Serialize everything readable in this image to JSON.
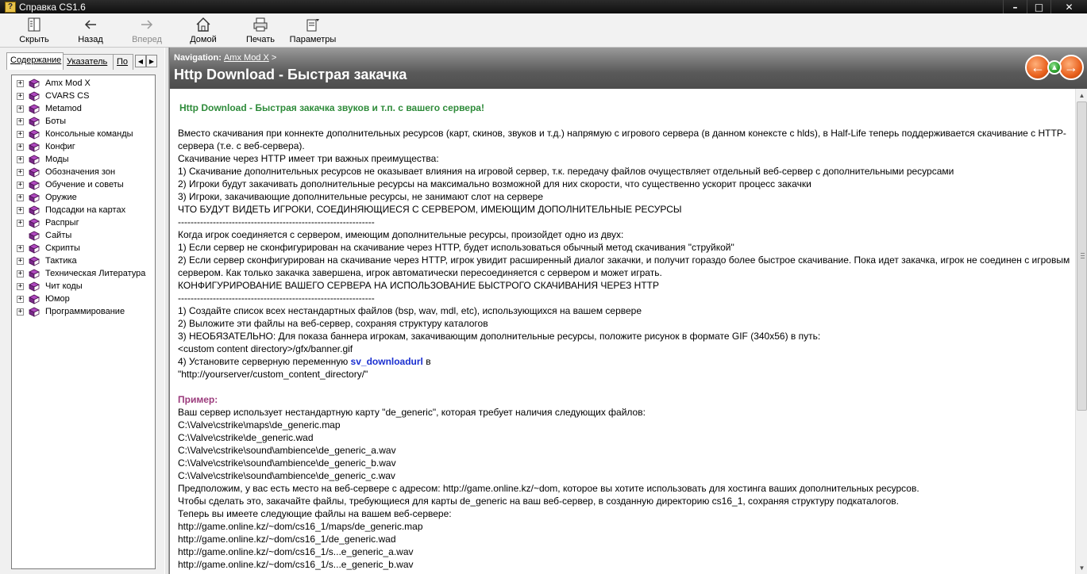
{
  "window": {
    "title": "Справка CS1.6",
    "icon": "help-book-icon",
    "controls": [
      "minimize-icon",
      "maximize-icon",
      "close-icon"
    ]
  },
  "toolbar": {
    "hide_label": "Скрыть",
    "back_label": "Назад",
    "forward_label": "Вперед",
    "home_label": "Домой",
    "print_label": "Печать",
    "options_label": "Параметры"
  },
  "sidebar": {
    "tabs": [
      "Содержание",
      "Указатель",
      "По"
    ],
    "items": [
      {
        "label": "Amx Mod X",
        "expandable": true
      },
      {
        "label": "CVARS CS",
        "expandable": true
      },
      {
        "label": "Metamod",
        "expandable": true
      },
      {
        "label": "Боты",
        "expandable": true
      },
      {
        "label": "Консольные команды",
        "expandable": true
      },
      {
        "label": "Конфиг",
        "expandable": true
      },
      {
        "label": "Моды",
        "expandable": true
      },
      {
        "label": "Обозначения зон",
        "expandable": true
      },
      {
        "label": "Обучение и советы",
        "expandable": true
      },
      {
        "label": "Оружие",
        "expandable": true
      },
      {
        "label": "Подсадки на картах",
        "expandable": true
      },
      {
        "label": "Распрыг",
        "expandable": true
      },
      {
        "label": "Сайты",
        "expandable": false
      },
      {
        "label": "Скрипты",
        "expandable": true
      },
      {
        "label": "Тактика",
        "expandable": true
      },
      {
        "label": "Техническая Литература",
        "expandable": true
      },
      {
        "label": "Чит коды",
        "expandable": true
      },
      {
        "label": "Юмор",
        "expandable": true
      },
      {
        "label": "Программирование",
        "expandable": true
      }
    ]
  },
  "header": {
    "nav_prefix": "Navigation:",
    "nav_link": "Amx Mod X",
    "nav_sep": ">",
    "title": "Http Download  - Быстрая закачка"
  },
  "article": {
    "heading": "Http Download  - Быстрая закачка звуков и т.п. с вашего сервера!",
    "para1": [
      "Вместо скачивания при коннекте дополнительных ресурсов (карт, скинов, звуков и т.д.) напрямую с игрового сервера (в данном конексте с hlds), в Half-Life теперь поддерживается скачивание с HTTP-сервера (т.е. с веб-сервера).",
      "Скачивание через HTTP имеет три важных преимущества:",
      "1) Скачивание дополнительных ресурсов не оказывает влияния на игровой сервер, т.к. передачу файлов очуществляет отдельный веб-сервер с дополнительными ресурсами",
      "2) Игроки будут закачивать дополнительные ресурсы на максимально возможной для них скорости, что существенно ускорит процесс закачки",
      "3) Игроки, закачивающие дополнительные ресурсы, не занимают слот на сервере",
      "ЧТО БУДУТ ВИДЕТЬ ИГРОКИ, СОЕДИНЯЮЩИЕСЯ С СЕРВЕРОМ, ИМЕЮЩИМ ДОПОЛНИТЕЛЬНЫЕ РЕСУРСЫ",
      "--------------------------------------------------------------",
      "Когда игрок соединяется с сервером, имеющим дополнительные ресурсы, произойдет одно из двух:",
      "1) Если сервер не сконфигурирован на скачивание через HTTP, будет использоваться обычный метод скачивания \"струйкой\"",
      "2) Если сервер сконфигурирован на скачивание через HTTP, игрок увидит расширенный диалог закачки, и получит гораздо более быстрое скачивание. Пока идет закачка, игрок не соединен с игровым сервером. Как только закачка завершена, игрок автоматически пересоединяется с сервером и может играть.",
      "КОНФИГУРИРОВАНИЕ ВАШЕГО СЕРВЕРА НА ИСПОЛЬЗОВАНИЕ БЫСТРОГО СКАЧИВАНИЯ ЧЕРЕЗ HTTP",
      "--------------------------------------------------------------",
      "1) Создайте список всех нестандартных файлов (bsp, wav, mdl, etc), использующихся на вашем сервере",
      "2) Выложите эти файлы на веб-сервер, сохраняя структуру каталогов",
      "3) НЕОБЯЗАТЕЛЬНО: Для показа баннера игрокам, закачивающим дополнительные ресурсы, положите рисунок в формате GIF (340x56) в путь:",
      "<custom content directory>/gfx/banner.gif"
    ],
    "step4_prefix": "4) Установите серверную переменную ",
    "step4_cvar": "sv_downloadurl",
    "step4_suffix": " в",
    "step4_value": "\"http://yourserver/custom_content_directory/\"",
    "example_heading": "Пример:",
    "para2": [
      "Ваш сервер использует нестандартную карту \"de_generic\", которая требует наличия следующих файлов:",
      "C:\\Valve\\cstrike\\maps\\de_generic.map",
      "C:\\Valve\\cstrike\\de_generic.wad",
      "C:\\Valve\\cstrike\\sound\\ambience\\de_generic_a.wav",
      "C:\\Valve\\cstrike\\sound\\ambience\\de_generic_b.wav",
      "C:\\Valve\\cstrike\\sound\\ambience\\de_generic_c.wav",
      "Предположим, у вас есть место на веб-сервере с адресом: http://game.online.kz/~dom, которое вы хотите использовать для хостинга ваших дополнительных ресурсов.",
      "Чтобы сделать это, закачайте файлы, требующиеся для карты de_generic на ваш веб-сервер, в созданную директорию cs16_1, сохраняя структуру подкаталогов.",
      "Теперь вы имеете следующие файлы на вашем веб-сервере:",
      "http://game.online.kz/~dom/cs16_1/maps/de_generic.map",
      "http://game.online.kz/~dom/cs16_1/de_generic.wad",
      "http://game.online.kz/~dom/cs16_1/s...e_generic_a.wav",
      "http://game.online.kz/~dom/cs16_1/s...e_generic_b.wav"
    ]
  },
  "colors": {
    "heading_green": "#2e8b3a",
    "cvar_blue": "#1a2fd0",
    "subhead_purple": "#9b3b7c",
    "nav_buttons": "#e8601d"
  }
}
